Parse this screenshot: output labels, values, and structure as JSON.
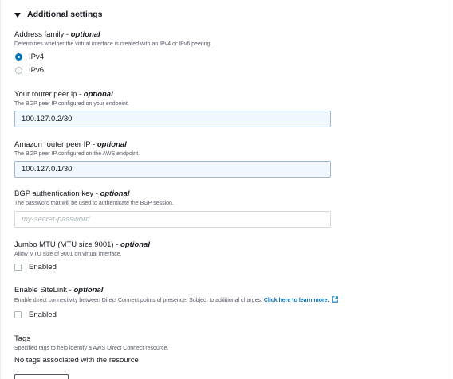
{
  "section": {
    "title": "Additional settings"
  },
  "address_family": {
    "label": "Address family - ",
    "optional": "optional",
    "description": "Determines whether the virtual interface is created with an IPv4 or IPv6 peering.",
    "options": [
      {
        "label": "IPv4",
        "checked": true
      },
      {
        "label": "IPv6",
        "checked": false
      }
    ]
  },
  "router_peer_ip": {
    "label": "Your router peer ip - ",
    "optional": "optional",
    "description": "The BGP peer IP configured on your endpoint.",
    "value": "100.127.0.2/30"
  },
  "amazon_peer_ip": {
    "label": "Amazon router peer IP - ",
    "optional": "optional",
    "description": "The BGP peer IP configured on the AWS endpoint.",
    "value": "100.127.0.1/30"
  },
  "bgp_auth_key": {
    "label": "BGP authentication key - ",
    "optional": "optional",
    "description": "The password that will be used to authenticate the BGP session.",
    "value": "",
    "placeholder": "my-secret-password"
  },
  "jumbo_mtu": {
    "label": "Jumbo MTU (MTU size 9001) - ",
    "optional": "optional",
    "description": "Allow MTU size of 9001 on virtual interface.",
    "checkbox_label": "Enabled",
    "checked": false
  },
  "sitelink": {
    "label": "Enable SiteLink - ",
    "optional": "optional",
    "description": "Enable direct connectivity between Direct Connect points of presence. Subject to additional charges. ",
    "link_text": "Click here to learn more.",
    "link_icon": "external-link-icon",
    "checkbox_label": "Enabled",
    "checked": false
  },
  "tags": {
    "label": "Tags",
    "description": "Specified tags to help identify a AWS Direct Connect resource.",
    "empty_text": "No tags associated with the resource"
  },
  "colors": {
    "link": "#0073bb",
    "input_filled_bg": "#f1f7fe",
    "radio_checked": "#0073bb"
  }
}
